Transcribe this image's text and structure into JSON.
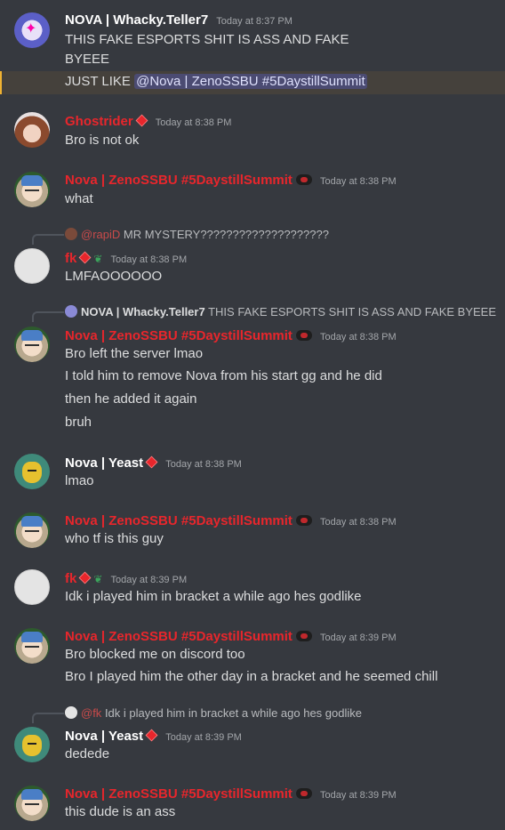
{
  "messages": [
    {
      "author": "NOVA | Whacky.Teller7",
      "time": "Today at 8:37 PM",
      "lines": [
        "THIS FAKE ESPORTS SHIT IS ASS AND FAKE",
        "BYEEE"
      ],
      "highlight_prefix": "JUST LIKE ",
      "mention": "@Nova | ZenoSSBU #5DaystillSummit"
    },
    {
      "author": "Ghostrider",
      "time": "Today at 8:38 PM",
      "lines": [
        "Bro is not ok"
      ]
    },
    {
      "author": "Nova | ZenoSSBU #5DaystillSummit",
      "time": "Today at 8:38 PM",
      "lines": [
        "what"
      ]
    },
    {
      "reply_author": "@rapiD",
      "reply_text": "MR MYSTERY????????????????????",
      "author": "fk",
      "time": "Today at 8:38 PM",
      "lines": [
        "LMFAOOOOOO"
      ]
    },
    {
      "reply_author": "NOVA | Whacky.Teller7",
      "reply_text": "THIS FAKE ESPORTS SHIT IS ASS AND FAKE BYEEE",
      "author": "Nova | ZenoSSBU #5DaystillSummit",
      "time": "Today at 8:38 PM",
      "lines": [
        "Bro left the server lmao",
        "I told him to remove Nova from his start gg and he did",
        "then he added it again",
        "bruh"
      ]
    },
    {
      "author": "Nova | Yeast",
      "time": "Today at 8:38 PM",
      "lines": [
        "lmao"
      ]
    },
    {
      "author": "Nova | ZenoSSBU #5DaystillSummit",
      "time": "Today at 8:38 PM",
      "lines": [
        "who tf is this guy"
      ]
    },
    {
      "author": "fk",
      "time": "Today at 8:39 PM",
      "lines": [
        "Idk i played him in bracket a while ago hes godlike"
      ]
    },
    {
      "author": "Nova | ZenoSSBU #5DaystillSummit",
      "time": "Today at 8:39 PM",
      "lines": [
        "Bro blocked me on discord too",
        "Bro I played him the other day in a bracket and he seemed chill"
      ]
    },
    {
      "reply_author": "@fk",
      "reply_text": "Idk i played him in bracket a while ago hes godlike",
      "author": "Nova | Yeast",
      "time": "Today at 8:39 PM",
      "lines": [
        "dedede"
      ]
    },
    {
      "author": "Nova | ZenoSSBU #5DaystillSummit",
      "time": "Today at 8:39 PM",
      "lines": [
        "this dude is an ass"
      ]
    }
  ],
  "colors": {
    "background": "#36393f",
    "role_red": "#e8262c",
    "mention_bg": "#4f5592"
  }
}
